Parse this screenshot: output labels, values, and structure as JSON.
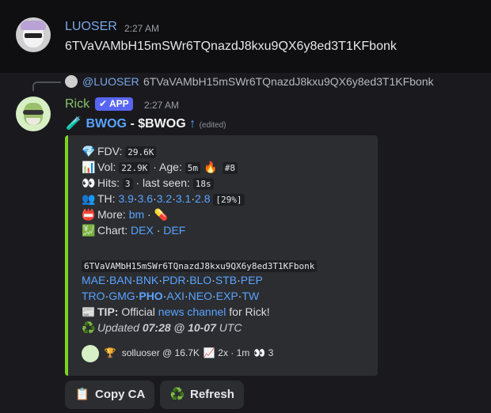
{
  "message1": {
    "username": "LUOSER",
    "time": "2:27 AM",
    "text": "6TVaVAMbH15mSWr6TQnazdJ8kxu9QX6y8ed3T1KFbonk"
  },
  "reply": {
    "username": "@LUOSER",
    "text": "6TVaVAMbH15mSWr6TQnazdJ8kxu9QX6y8ed3T1KFbonk"
  },
  "message2": {
    "username": "Rick",
    "badge": "✔ APP",
    "time": "2:27 AM",
    "title_link": "BWOG",
    "title_sep": " - ",
    "title_ticker": "$BWOG",
    "title_arrow": "↑",
    "edited": "(edited)"
  },
  "embed": {
    "fdv_label": "FDV:",
    "fdv_value": "29.6K",
    "vol_label": "Vol:",
    "vol_value": "22.9K",
    "age_label": "· Age:",
    "age_value": "5m",
    "rank": "#8",
    "hits_label": "Hits:",
    "hits_value": "3",
    "last_seen_label": "· last seen:",
    "last_seen_value": "18s",
    "th_label": "TH:",
    "th_values": [
      "3.9",
      "3.6",
      "3.2",
      "3.1",
      "2.8"
    ],
    "th_pct": "[29%]",
    "more_label": "More:",
    "more_link": "bm",
    "chart_label": "Chart:",
    "chart_links": [
      "DEX",
      "DEF"
    ],
    "ca": "6TVaVAMbH15mSWr6TQnazdJ8kxu9QX6y8ed3T1KFbonk",
    "links_row1": [
      "MAE",
      "BAN",
      "BNK",
      "PDR",
      "BLO",
      "STB",
      "PEP"
    ],
    "links_row2": [
      "TRO",
      "GMG",
      "PHO",
      "AXI",
      "NEO",
      "EXP",
      "TW"
    ],
    "tip_label": "TIP:",
    "tip_pre": "Official",
    "tip_link": "news channel",
    "tip_post": "for Rick!",
    "updated_pre": "Updated",
    "updated_time": "07:28 @ 10-07",
    "updated_tz": "UTC",
    "footer_user": "solluoser @ 16.7K",
    "footer_stats": "2x · 1m",
    "footer_count": "3"
  },
  "buttons": {
    "copy_ca": "Copy CA",
    "refresh": "Refresh"
  },
  "colors": {
    "accent_bar": "#7ed321",
    "link": "#5aa3ff",
    "app_badge": "#5865f2"
  }
}
